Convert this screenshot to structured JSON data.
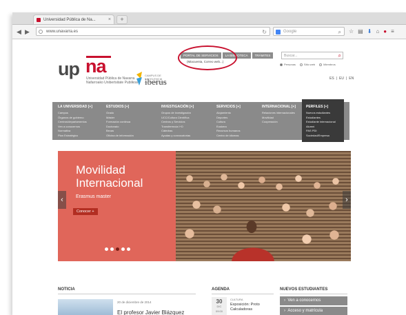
{
  "browser": {
    "tab_title": "Universidad Pública de Na...",
    "tab_close": "×",
    "new_tab": "+",
    "url": "www.unavarra.es",
    "search_engine": "Google",
    "back": "◀",
    "forward": "▶"
  },
  "header": {
    "logo_up": "up",
    "logo_na": "na",
    "logo_line1": "Universidad Pública de Navarra",
    "logo_line2": "Nafarroako Unibertsitate Publikoa",
    "iberus_small": "CAMPUS DE EXCELENCIA INTERNACIONAL",
    "iberus": "iberus",
    "top_buttons": [
      "PORTAL DE SERVICIOS",
      "LA BIBLIOTECA",
      "TRÁMITES"
    ],
    "top_note": "(Miacuenta, Correo web...)",
    "search_placeholder": "Buscar...",
    "radios": [
      "Personas",
      "Sitio web",
      "Miembros"
    ],
    "langs": [
      "ES",
      "EU",
      "EN"
    ]
  },
  "menu": [
    {
      "title": "LA UNIVERSIDAD [+]",
      "items": [
        "Campus",
        "Órganos de gobierno",
        "Centros/departamentos",
        "Ven a conocernos",
        "Normativa",
        "Plan Estratégico"
      ]
    },
    {
      "title": "ESTUDIOS [+]",
      "items": [
        "Grado",
        "Máster",
        "Formación continua",
        "Doctorado",
        "Becas",
        "Oficina de información"
      ]
    },
    {
      "title": "INVESTIGACIÓN [+]",
      "items": [
        "Grupos de investigación",
        "UCC/Cultura Científica",
        "Centros y Servicios",
        "Transferencia I+D",
        "Cátedras",
        "Ayudas y convocatorias"
      ]
    },
    {
      "title": "SERVICIOS [+]",
      "items": [
        "Alojamiento",
        "Deportes",
        "Cultura",
        "Euskera",
        "Recursos humanos",
        "Centro de idiomas"
      ]
    },
    {
      "title": "INTERNACIONAL [+]",
      "items": [
        "Relaciones internacionales",
        "Movilidad",
        "Cooperación"
      ]
    },
    {
      "title": "PERFILES [+]",
      "items": [
        "Nuevos estudiantes",
        "Estudiantes",
        "Estudiante internacional",
        "Alumni",
        "PAS    PDI",
        "Sociedad/Empresa"
      ]
    }
  ],
  "hero": {
    "title_line1": "Movilidad",
    "title_line2": "Internacional",
    "subtitle": "Erasmus master",
    "button": "Conocer +",
    "prev": "‹",
    "next": "›",
    "active_slide": 3,
    "slide_count": 5
  },
  "news": {
    "heading": "NOTICIA",
    "date": "20 de diciembre de 2014",
    "title": "El profesor Javier Blázquez"
  },
  "agenda": {
    "heading": "AGENDA",
    "day": "30",
    "month": "DIC",
    "time": "09:00",
    "category": "CULTURA",
    "title": "Exposición: Proto Calculadoras"
  },
  "new_students": {
    "heading": "NUEVOS ESTUDIANTES",
    "links": [
      "Ven a conocernos",
      "Acceso y matrícula"
    ]
  },
  "colors": {
    "brand_red": "#c8102e",
    "menu_gray": "#8a8a8a",
    "hero_red": "#e0665a"
  }
}
